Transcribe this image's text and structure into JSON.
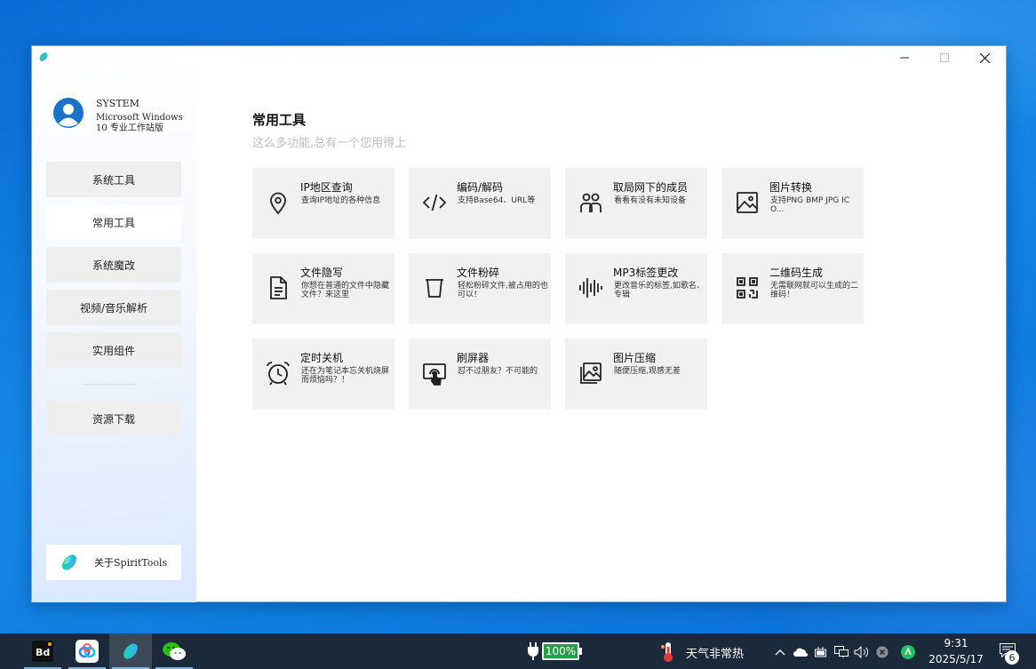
{
  "sidebar": {
    "user": {
      "name": "SYSTEM",
      "os": "Microsoft Windows 10 专业工作站版"
    },
    "nav": [
      {
        "label": "系统工具",
        "active": false
      },
      {
        "label": "常用工具",
        "active": true
      },
      {
        "label": "系统魔改",
        "active": false
      },
      {
        "label": "视频/音乐解析",
        "active": false
      },
      {
        "label": "实用组件",
        "active": false
      },
      {
        "label": "资源下载",
        "active": false
      }
    ],
    "about_label": "关于SpiritTools"
  },
  "main": {
    "title": "常用工具",
    "subtitle": "这么多功能,总有一个您用得上",
    "cards": [
      {
        "title": "IP地区查询",
        "desc": "查询IP地址的各种信息",
        "icon": "location-pin-icon"
      },
      {
        "title": "编码/解码",
        "desc": "支持Base64、URL等",
        "icon": "code-icon"
      },
      {
        "title": "取局网下的成员",
        "desc": "看看有没有未知设备",
        "icon": "users-icon"
      },
      {
        "title": "图片转换",
        "desc": "支持PNG BMP JPG ICO...",
        "icon": "image-icon"
      },
      {
        "title": "文件隐写",
        "desc": "你想在普通的文件中隐藏文件？来这里",
        "icon": "document-icon"
      },
      {
        "title": "文件粉碎",
        "desc": "轻松粉碎文件,被占用的也可以！",
        "icon": "trash-icon"
      },
      {
        "title": "MP3标签更改",
        "desc": "更改音乐的标签,如歌名、专辑",
        "icon": "soundwave-icon"
      },
      {
        "title": "二维码生成",
        "desc": "无需联网就可以生成的二维码！",
        "icon": "qrcode-icon"
      },
      {
        "title": "定时关机",
        "desc": "还在为笔记本忘关机烧屏而烦恼吗？！",
        "icon": "alarm-clock-icon"
      },
      {
        "title": "刷屏器",
        "desc": "怼不过朋友？不可能的",
        "icon": "touch-screen-icon"
      },
      {
        "title": "图片压缩",
        "desc": "随便压缩,观感无差",
        "icon": "image-compress-icon"
      }
    ]
  },
  "taskbar": {
    "battery": "100%",
    "weather": "天气非常热",
    "time": "9:31",
    "date": "2025/5/17",
    "notifications": "6",
    "apps": [
      "bd-app-icon",
      "baidu-netdisk-icon",
      "spirittools-icon",
      "wechat-icon"
    ]
  },
  "colors": {
    "accent": "#0a6cd6",
    "card_bg": "#f1f1f1",
    "taskbar": "#1b2a3b"
  }
}
